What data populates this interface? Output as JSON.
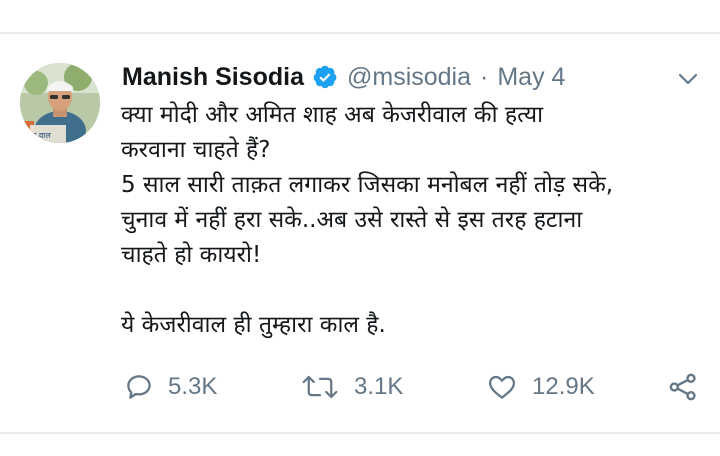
{
  "tweet": {
    "author_name": "Manish Sisodia",
    "handle": "@msisodia",
    "separator": "·",
    "date": "May 4",
    "text_lines": [
      "क्या मोदी और अमित शाह अब केजरीवाल की हत्या",
      "करवाना चाहते हैं?",
      "5 साल सारी ताक़त लगाकर जिसका मनोबल नहीं तोड़ सके,",
      "चुनाव में नहीं हरा सके..अब उसे रास्ते से इस तरह हटाना",
      "चाहते हो कायरो!",
      "ये केजरीवाल ही तुम्हारा काल है."
    ],
    "avatar_caption": "र वाल"
  },
  "actions": {
    "reply_count": "5.3K",
    "retweet_count": "3.1K",
    "like_count": "12.9K"
  },
  "colors": {
    "text": "#14171a",
    "secondary": "#657786",
    "verified": "#1da1f2",
    "divider": "#e6ecf0"
  },
  "icons": {
    "verified": "verified-badge-icon",
    "menu": "chevron-down-icon",
    "reply": "reply-icon",
    "retweet": "retweet-icon",
    "like": "heart-icon",
    "share": "share-icon"
  }
}
